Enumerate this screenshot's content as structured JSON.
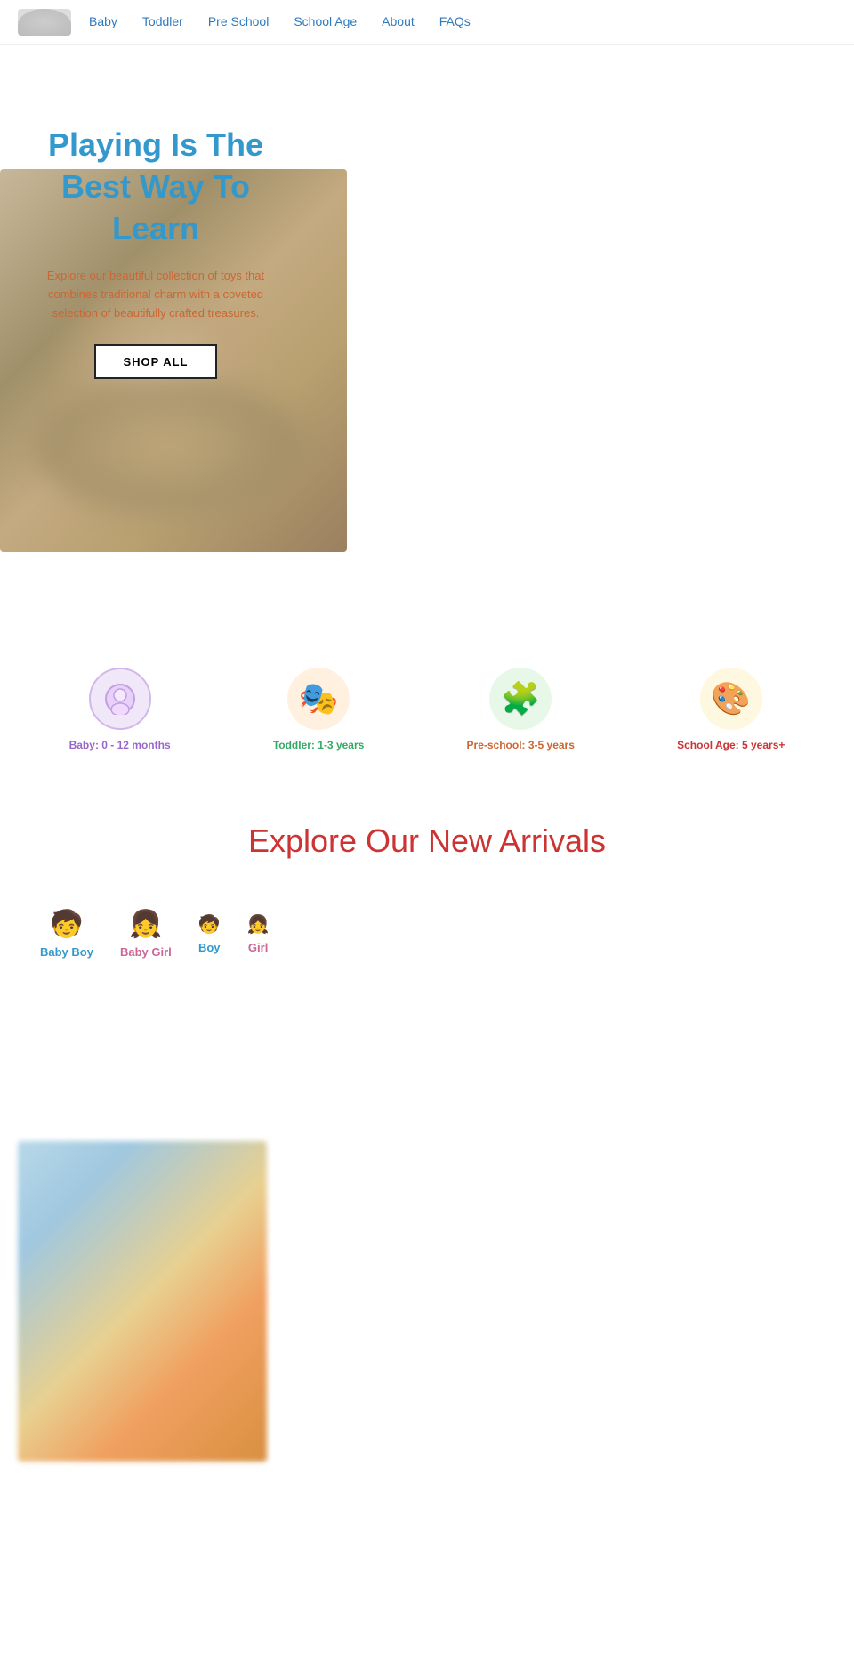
{
  "nav": {
    "logo_alt": "Logo",
    "links": [
      {
        "id": "baby",
        "label": "Baby"
      },
      {
        "id": "toddler",
        "label": "Toddler"
      },
      {
        "id": "preschool",
        "label": "Pre School"
      },
      {
        "id": "schoolage",
        "label": "School Age"
      },
      {
        "id": "about",
        "label": "About"
      },
      {
        "id": "faqs",
        "label": "FAQs"
      }
    ]
  },
  "hero": {
    "title": "Playing Is The Best Way To Learn",
    "subtitle": "Explore our beautiful collection of toys that combines traditional charm with a coveted selection of beautifully crafted treasures.",
    "cta_label": "SHOP ALL"
  },
  "age_categories": [
    {
      "id": "baby",
      "icon": "🔵",
      "label": "Baby: 0 - 12 months",
      "color_class": "baby-color",
      "icon_class": "baby"
    },
    {
      "id": "toddler",
      "icon": "🎭",
      "label": "Toddler: 1-3 years",
      "color_class": "toddler-color",
      "icon_class": "toddler"
    },
    {
      "id": "preschool",
      "icon": "🧩",
      "label": "Pre-school: 3-5 years",
      "color_class": "preschool-color",
      "icon_class": "preschool"
    },
    {
      "id": "schoolage",
      "icon": "🎨",
      "label": "School Age: 5 years+",
      "color_class": "schoolage-color",
      "icon_class": "schoolage"
    }
  ],
  "new_arrivals": {
    "title": "Explore Our New Arrivals"
  },
  "gender_tabs": [
    {
      "id": "baby-boy",
      "icon": "🧒",
      "label": "Baby Boy",
      "color_class": "boy-color"
    },
    {
      "id": "baby-girl",
      "icon": "👧",
      "label": "Baby Girl",
      "color_class": "girl-color"
    },
    {
      "id": "boy",
      "mini_icon": "🧒",
      "label": "Boy",
      "color_class": "boy-color"
    },
    {
      "id": "girl",
      "mini_icon": "👧",
      "label": "Girl",
      "color_class": "girl-color"
    }
  ]
}
